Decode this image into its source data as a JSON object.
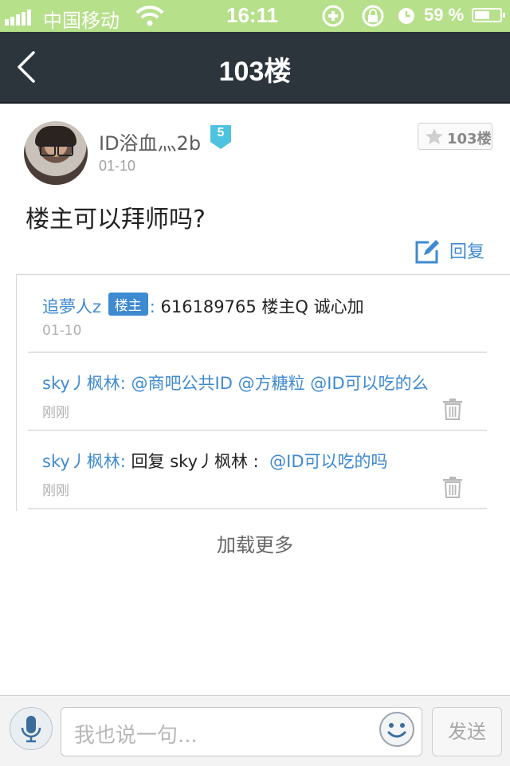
{
  "status_bar": {
    "carrier": "中国移动",
    "time": "16:11",
    "battery": "59 %",
    "battery_level": 0.59,
    "icons": [
      "signal-icon",
      "wifi-icon",
      "rotation-lock-icon",
      "lock-icon",
      "alarm-icon",
      "battery-icon"
    ]
  },
  "nav": {
    "title": "103楼",
    "back_icon": "chevron-left-icon"
  },
  "post": {
    "username": "ID浴血灬2b",
    "level": "5",
    "date": "01-10",
    "floor_label": "103楼",
    "content": "楼主可以拜师吗?",
    "reply_label": "回复"
  },
  "sub_replies": [
    {
      "author": "追夢人z",
      "tag": "楼主",
      "colon": ": ",
      "text": "616189765 楼主Q 诚心加",
      "time": "01-10"
    },
    {
      "author": "sky丿枫林",
      "colon": ": ",
      "text": "@商吧公共ID @方糖粒 @ID可以吃的么",
      "time": "刚刚"
    },
    {
      "author": "sky丿枫林",
      "colon": ": ",
      "text_prefix": "回复 sky丿枫林 :",
      "text_mention": "@ID可以吃的吗",
      "time": "刚刚"
    }
  ],
  "load_more": "加载更多",
  "composer": {
    "placeholder": "我也说一句...",
    "send_label": "发送"
  },
  "colors": {
    "status_bar": "#b6e08a",
    "nav_bar": "#2c343c",
    "link_blue": "#3f8ad0",
    "level_badge": "#4ec3e0"
  }
}
